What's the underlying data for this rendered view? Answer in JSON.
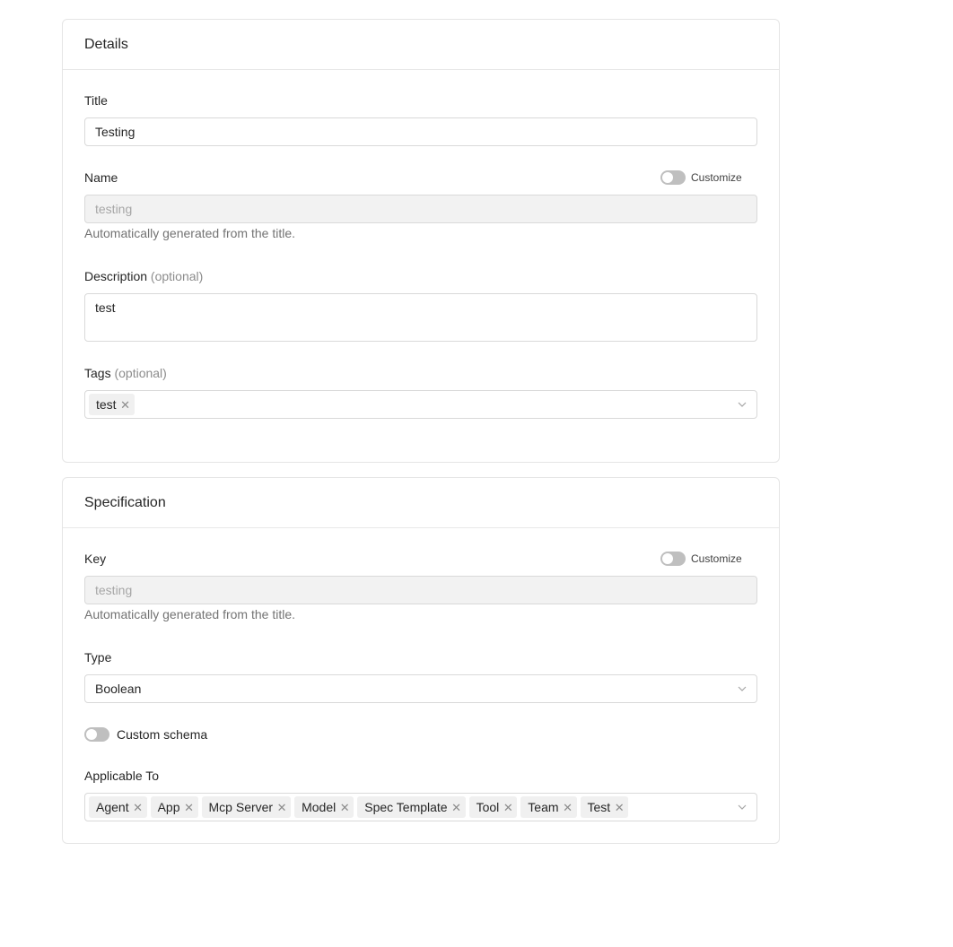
{
  "details": {
    "title": "Details",
    "title_field": {
      "label": "Title",
      "value": "Testing"
    },
    "name_field": {
      "label": "Name",
      "value": "testing",
      "help": "Automatically generated from the title.",
      "customize_label": "Customize"
    },
    "description_field": {
      "label": "Description",
      "optional": "(optional)",
      "value": "test"
    },
    "tags_field": {
      "label": "Tags",
      "optional": "(optional)",
      "tags": [
        "test"
      ]
    }
  },
  "specification": {
    "title": "Specification",
    "key_field": {
      "label": "Key",
      "value": "testing",
      "help": "Automatically generated from the title.",
      "customize_label": "Customize"
    },
    "type_field": {
      "label": "Type",
      "value": "Boolean"
    },
    "custom_schema_label": "Custom schema",
    "applicable_to": {
      "label": "Applicable To",
      "tags": [
        "Agent",
        "App",
        "Mcp Server",
        "Model",
        "Spec Template",
        "Tool",
        "Team",
        "Test"
      ]
    }
  },
  "icons": {
    "remove": "close-icon",
    "dropdown": "chevron-down-icon"
  }
}
